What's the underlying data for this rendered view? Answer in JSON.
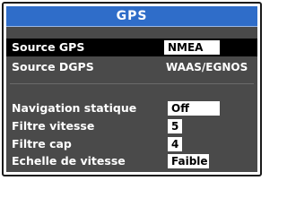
{
  "dialog": {
    "title": "GPS",
    "rows": [
      {
        "label": "Source GPS",
        "value": "NMEA"
      },
      {
        "label": "Source DGPS",
        "value": "WAAS/EGNOS"
      },
      {
        "label": "Navigation statique",
        "value": "Off"
      },
      {
        "label": "Filtre vitesse",
        "value": "5"
      },
      {
        "label": "Filtre cap",
        "value": "4"
      },
      {
        "label": "Echelle de vitesse",
        "value": "Faible"
      }
    ]
  },
  "colors": {
    "title_bar": "#2f6dc9",
    "panel": "#4a4a4a",
    "selected_row": "#000000",
    "field": "#ffffff"
  }
}
